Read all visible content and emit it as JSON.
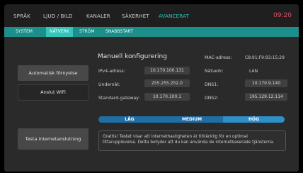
{
  "top_tabs": [
    {
      "label": "SPRÅK",
      "active": false
    },
    {
      "label": "LJUD / BILD",
      "active": false
    },
    {
      "label": "KANALER",
      "active": false
    },
    {
      "label": "SÄKERHET",
      "active": false
    },
    {
      "label": "AVANCERAT",
      "active": true
    }
  ],
  "clock": "09:20",
  "sub_tabs": [
    {
      "label": "SYSTEM",
      "active": false
    },
    {
      "label": "NÄTVERK",
      "active": true
    },
    {
      "label": "STRÖM",
      "active": false
    },
    {
      "label": "SNABBSTART",
      "active": false
    }
  ],
  "buttons": {
    "auto_renew": "Automatisk förnyelse",
    "connect_wifi": "Anslut WiFi",
    "test_internet": "Testa internetanslutning"
  },
  "manual_config": {
    "heading": "Manuell konfigurering",
    "ipv4_label": "IPv4-adress:",
    "ipv4_value": "10.170.100.131",
    "subnet_label": "Undernät:",
    "subnet_value": "255.255.252.0",
    "gateway_label": "Standard-gateway:",
    "gateway_value": "10.170.100.1"
  },
  "network_info": {
    "mac_label": "MAC-adress:",
    "mac_value": "C8:91:F9:93:15:29",
    "network_label": "Nätverk:",
    "network_value": "LAN",
    "dns1_label": "DNS1:",
    "dns1_value": "10.170.9.140",
    "dns2_label": "DNS2:",
    "dns2_value": "195.129.12.114"
  },
  "speed": {
    "low": "LÅG",
    "medium": "MEDIUM",
    "high": "HÖG",
    "level": "HÖG"
  },
  "speed_message": "Grattis! Testet visar att internethastigheten är tillräcklig för en optimal tittarupplevelse. Detta betyder att du kan använda de internetbaserade tjänsterna.",
  "colors": {
    "accent": "#2ec8c0",
    "subbar": "#1d8f8a",
    "clock": "#e0506a",
    "speed_fill": "#1e6fa8",
    "speed_current": "#2f8fc9"
  }
}
